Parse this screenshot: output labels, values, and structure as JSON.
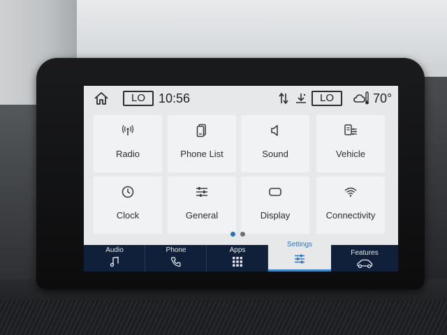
{
  "status_bar": {
    "left_climate": "LO",
    "time": "10:56",
    "right_climate": "LO",
    "temperature": "70°"
  },
  "tiles": [
    {
      "label": "Radio",
      "icon": "radio-signal-icon"
    },
    {
      "label": "Phone List",
      "icon": "phone-list-icon"
    },
    {
      "label": "Sound",
      "icon": "speaker-icon"
    },
    {
      "label": "Vehicle",
      "icon": "vehicle-settings-icon"
    },
    {
      "label": "Clock",
      "icon": "clock-icon"
    },
    {
      "label": "General",
      "icon": "sliders-icon"
    },
    {
      "label": "Display",
      "icon": "display-icon"
    },
    {
      "label": "Connectivity",
      "icon": "wifi-icon"
    }
  ],
  "pager": {
    "page_count": 2,
    "active_page": 1
  },
  "bottom_nav": [
    {
      "label": "Audio",
      "icon": "music-note-icon"
    },
    {
      "label": "Phone",
      "icon": "phone-handset-icon"
    },
    {
      "label": "Apps",
      "icon": "apps-grid-icon"
    },
    {
      "label": "Settings",
      "icon": "sliders-icon",
      "active": true
    },
    {
      "label": "Features",
      "icon": "car-icon"
    }
  ],
  "colors": {
    "nav_background": "#10203a",
    "active_accent": "#3b87c9",
    "page_dot_active": "#2f6fb0"
  }
}
